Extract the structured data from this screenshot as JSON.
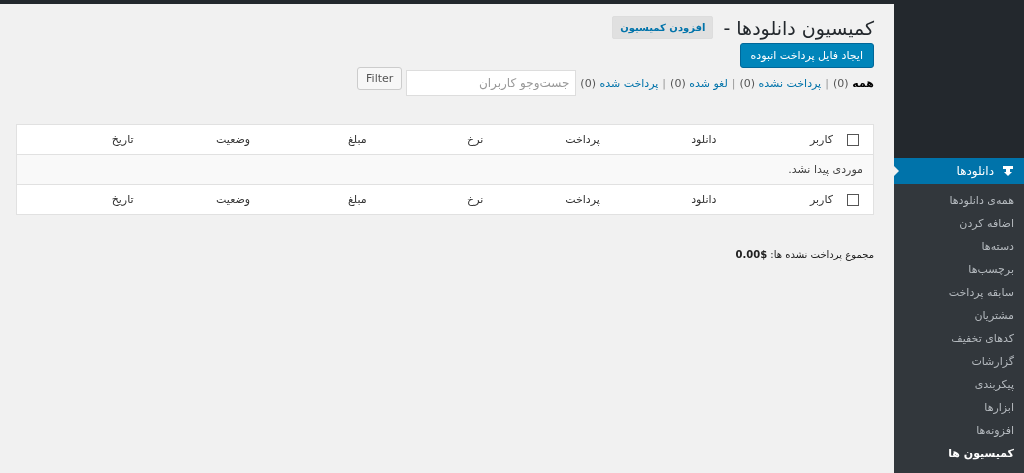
{
  "sidebar": {
    "menu": {
      "label": "دانلودها",
      "selected": true
    },
    "items": [
      {
        "label": "همه‌ی دانلودها",
        "selected": false
      },
      {
        "label": "اضافه کردن",
        "selected": false
      },
      {
        "label": "دسته‌ها",
        "selected": false
      },
      {
        "label": "برچسب‌ها",
        "selected": false
      },
      {
        "label": "سابقه پرداخت",
        "selected": false
      },
      {
        "label": "مشتریان",
        "selected": false
      },
      {
        "label": "کدهای تخفیف",
        "selected": false
      },
      {
        "label": "گزارشات",
        "selected": false
      },
      {
        "label": "پیکربندی",
        "selected": false
      },
      {
        "label": "ابزارها",
        "selected": false
      },
      {
        "label": "افزونه‌ها",
        "selected": false
      },
      {
        "label": "کمیسیون ها",
        "selected": true
      }
    ]
  },
  "page": {
    "title": "کمیسیون دانلودها -",
    "add_button": "افزودن کمیسیون",
    "export_button": "ایجاد فایل پرداخت انبوده"
  },
  "views": [
    {
      "label": "همه",
      "count": "(0)",
      "selected": true
    },
    {
      "separator": "|",
      "label": "پرداخت نشده",
      "count": "(0)",
      "selected": false
    },
    {
      "separator": "|",
      "label": "لغو شده",
      "count": "(0)",
      "selected": false
    },
    {
      "separator": "|",
      "label": "پرداخت شده",
      "count": "(0)",
      "selected": false
    }
  ],
  "search": {
    "placeholder": "جست‌وجو کاربران",
    "button": "Filter"
  },
  "table": {
    "header_checked": false,
    "footer_checked": false,
    "columns": [
      "کاربر",
      "دانلود",
      "پرداخت",
      "نرخ",
      "مبلغ",
      "وضعیت",
      "تاریخ"
    ],
    "empty_message": "موردی پیدا نشد.",
    "footer_columns": [
      "کاربر",
      "دانلود",
      "پرداخت",
      "نرخ",
      "مبلغ",
      "وضعیت",
      "تاریخ"
    ]
  },
  "total": "مجموع پرداخت نشده ها: **0.00$**"
}
